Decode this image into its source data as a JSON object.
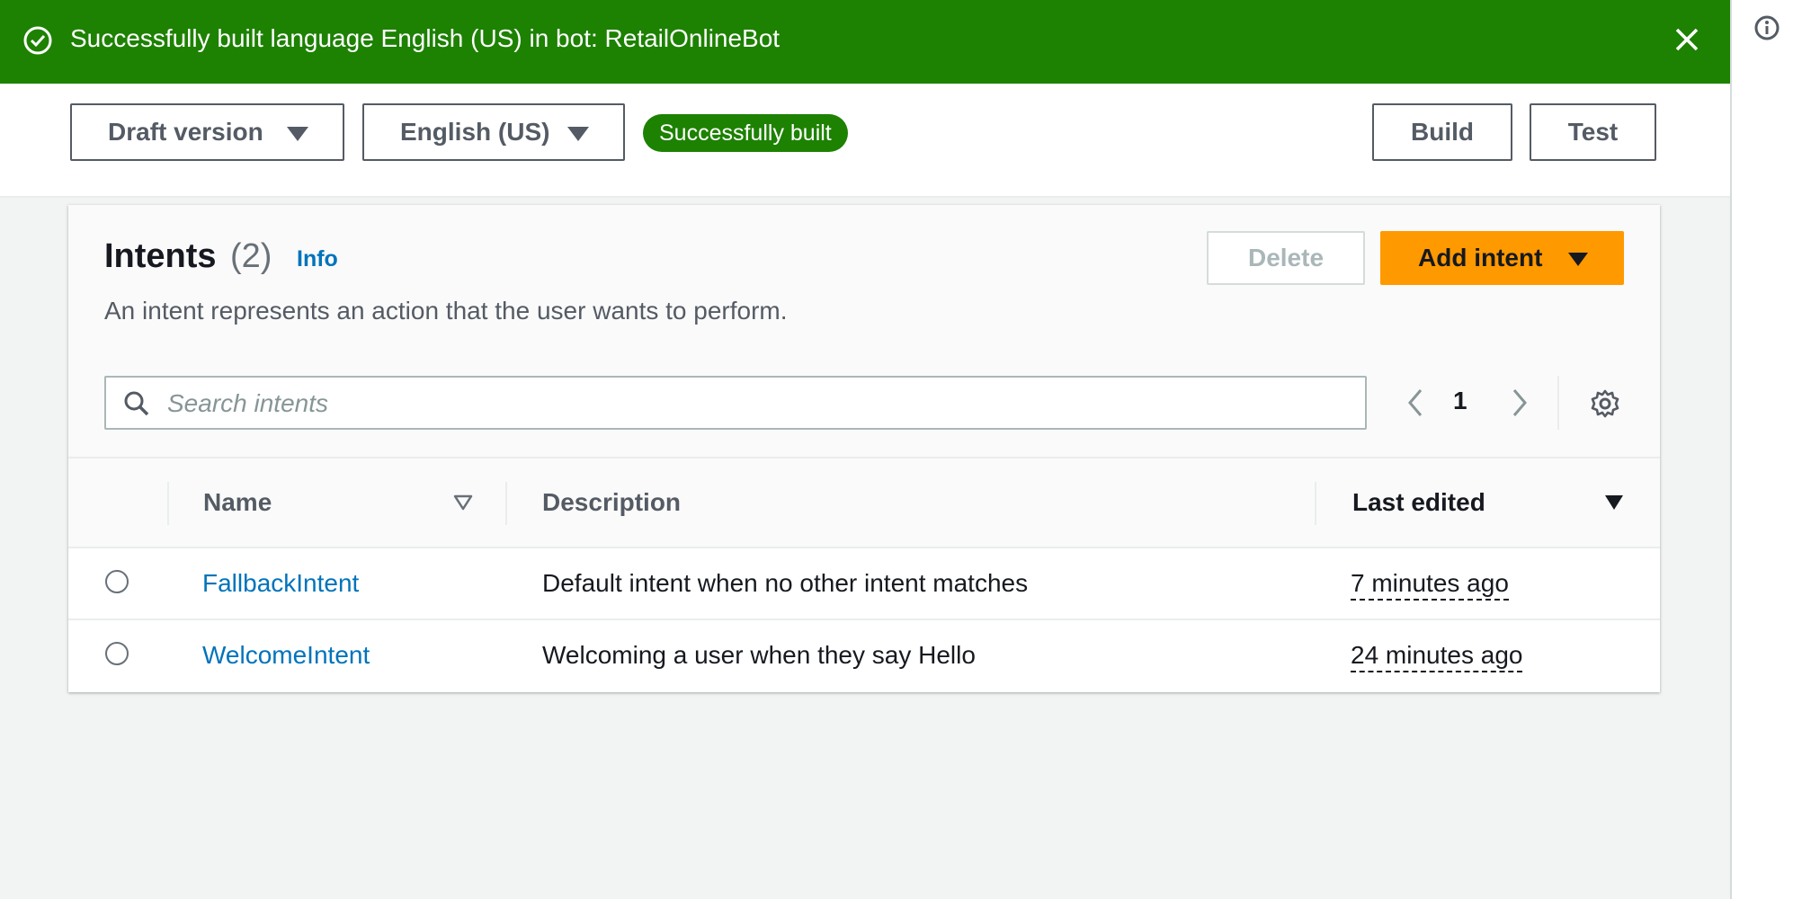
{
  "flash": {
    "message": "Successfully built language English (US) in bot: RetailOnlineBot",
    "status_icon": "check-circle-icon",
    "close_icon": "close-icon",
    "color": "#1d8102"
  },
  "toolbar": {
    "version_select": "Draft version",
    "language_select": "English (US)",
    "status_badge": "Successfully built",
    "build_label": "Build",
    "test_label": "Test"
  },
  "intents": {
    "title": "Intents",
    "count": "(2)",
    "info_label": "Info",
    "description": "An intent represents an action that the user wants to perform.",
    "delete_label": "Delete",
    "add_label": "Add intent",
    "search_placeholder": "Search intents",
    "search_value": "",
    "current_page": "1",
    "columns": {
      "name": "Name",
      "description": "Description",
      "last_edited": "Last edited"
    },
    "rows": [
      {
        "name": "FallbackIntent",
        "description": "Default intent when no other intent matches",
        "last_edited": "7 minutes ago"
      },
      {
        "name": "WelcomeIntent",
        "description": "Welcoming a user when they say Hello",
        "last_edited": "24 minutes ago"
      }
    ]
  },
  "colors": {
    "accent": "#ff9900",
    "link": "#0073bb",
    "success": "#1d8102"
  }
}
